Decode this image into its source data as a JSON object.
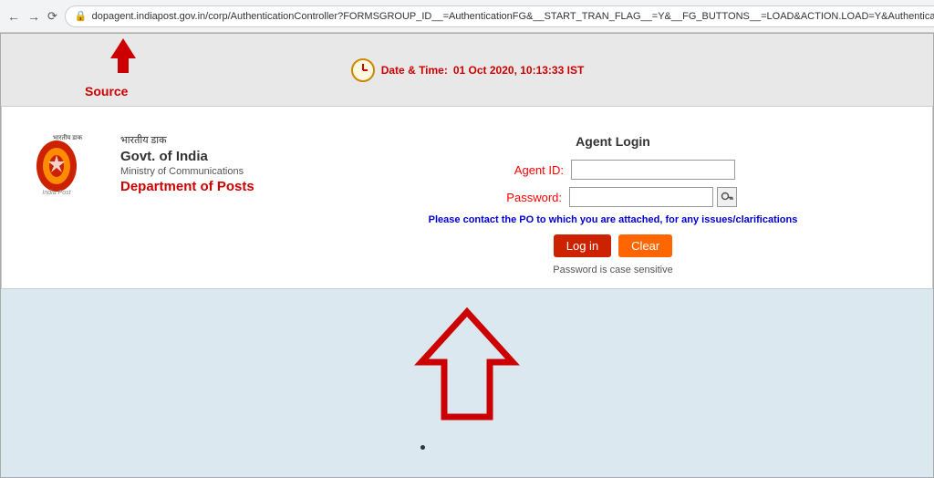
{
  "browser": {
    "url": "dopagent.indiapost.gov.in/corp/AuthenticationController?FORMSGROUP_ID__=AuthenticationFG&__START_TRAN_FLAG__=Y&__FG_BUTTONS__=LOAD&ACTION.LOAD=Y&AuthenticationFG.i",
    "back_btn": "←",
    "forward_btn": "→",
    "reload_btn": "↻"
  },
  "header": {
    "source_label": "Source",
    "datetime_label": "Date & Time:",
    "datetime_value": "01 Oct 2020, 10:13:33 IST"
  },
  "logo": {
    "satyamev": "भारतीय डाक",
    "govt_of_india": "Govt. of India",
    "ministry": "Ministry of Communications",
    "department": "Department of Posts",
    "india_post": "India Post"
  },
  "form": {
    "title": "Agent Login",
    "agent_id_label": "Agent ID:",
    "password_label": "Password:",
    "agent_id_value": "",
    "password_value": "",
    "agent_id_placeholder": "",
    "password_placeholder": "",
    "contact_message": "Please contact the PO to which you are attached, for any issues/clarifications",
    "login_btn": "Log in",
    "clear_btn": "Clear",
    "case_note": "Password is case sensitive"
  }
}
